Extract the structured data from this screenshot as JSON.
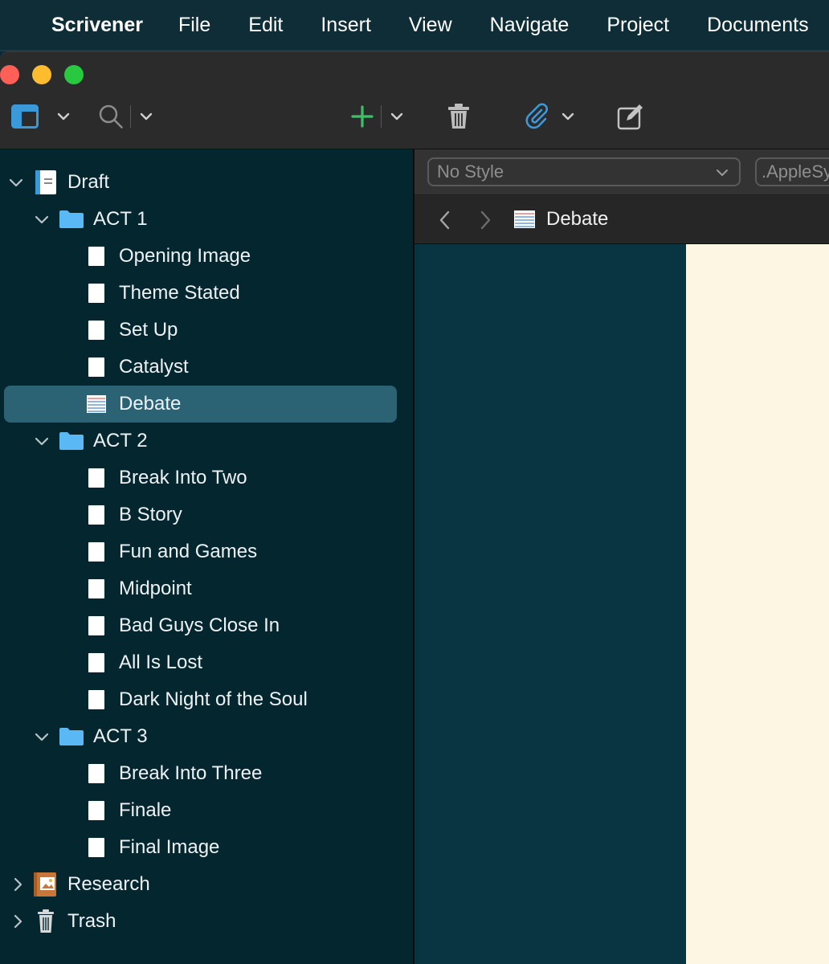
{
  "menubar": {
    "app_name": "Scrivener",
    "items": [
      "File",
      "Edit",
      "Insert",
      "View",
      "Navigate",
      "Project",
      "Documents"
    ]
  },
  "toolbar": {
    "icons": [
      "layout-icon",
      "search-icon",
      "add-icon",
      "trash-icon",
      "attachment-icon",
      "compose-icon"
    ],
    "accent_add": "#3fbf6a",
    "accent_attach": "#3a9ad9"
  },
  "binder": {
    "draft": {
      "label": "Draft",
      "acts": [
        {
          "label": "ACT 1",
          "items": [
            "Opening Image",
            "Theme Stated",
            "Set Up",
            "Catalyst",
            "Debate"
          ]
        },
        {
          "label": "ACT 2",
          "items": [
            "Break Into Two",
            "B Story",
            "Fun and Games",
            "Midpoint",
            "Bad Guys Close In",
            "All Is Lost",
            "Dark Night of the Soul"
          ]
        },
        {
          "label": "ACT 3",
          "items": [
            "Break Into Three",
            "Finale",
            "Final Image"
          ]
        }
      ]
    },
    "research": "Research",
    "trash": "Trash",
    "selected_item": "Debate",
    "selection_color": "#2b6375"
  },
  "format_bar": {
    "style_value": "No Style",
    "font_value": ".AppleSystemUIFont"
  },
  "editor_header": {
    "title": "Debate"
  },
  "colors": {
    "binder_bg": "#03262f",
    "editor_bg": "#093441",
    "page_bg": "#fdf6e3",
    "folder_blue": "#5ab8f5"
  }
}
